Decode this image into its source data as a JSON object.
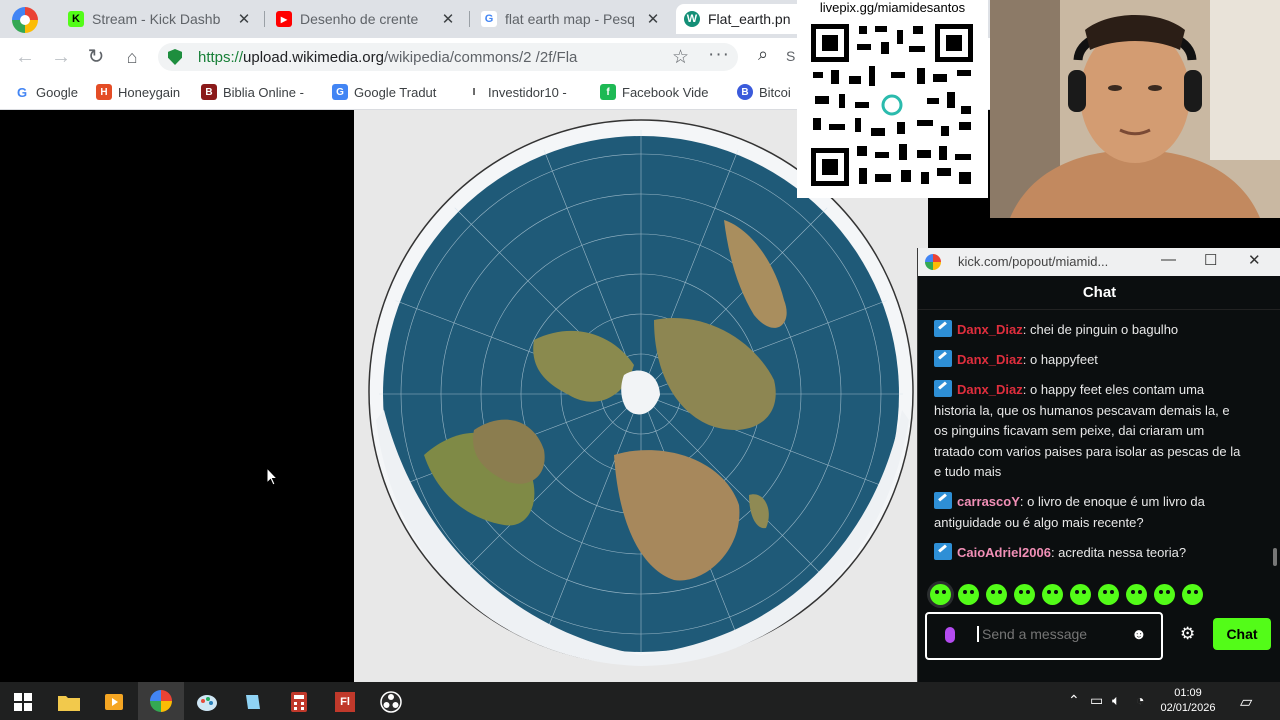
{
  "browser": {
    "tabs": [
      {
        "title": "Stream - Kick Dashb",
        "fav_color": "#53fc18",
        "fav_letter": "K"
      },
      {
        "title": "Desenho de crente",
        "fav_color": "#ff0000",
        "fav_letter": "▶"
      },
      {
        "title": "flat earth map - Pesq",
        "fav_color": "#4285f4",
        "fav_letter": "G"
      },
      {
        "title": "Flat_earth.pn",
        "fav_color": "#148f77",
        "fav_letter": "W"
      }
    ],
    "url_scheme": "https://",
    "url_host": "upload.wikimedia.org",
    "url_path": "/wikipedia/commons/2 /2f/Fla",
    "search_partial": "S",
    "bookmarks": [
      {
        "label": "Google",
        "color": "#4285f4",
        "letter": "G"
      },
      {
        "label": "Honeygain",
        "color": "#e44d26",
        "letter": "H"
      },
      {
        "label": "Biblia Online -",
        "color": "#8b1a1a",
        "letter": "B"
      },
      {
        "label": "Google Tradut",
        "color": "#4285f4",
        "letter": "G"
      },
      {
        "label": "Investidor10 -",
        "color": "#333333",
        "letter": "I"
      },
      {
        "label": "Facebook Vide",
        "color": "#1db954",
        "letter": "f"
      },
      {
        "label": "Bitcoi",
        "color": "#3b5bdb",
        "letter": "B"
      }
    ]
  },
  "overlay": {
    "qr_caption": "livepix.gg/miamidesantos"
  },
  "popout": {
    "window_title": "kick.com/popout/miamid...",
    "chat_title": "Chat",
    "messages": [
      {
        "user": "Danx_Diaz",
        "user_color": "#e02e3d",
        "text": ": chei de pinguin o bagulho"
      },
      {
        "user": "Danx_Diaz",
        "user_color": "#e02e3d",
        "text": ": o happyfeet"
      },
      {
        "user": "Danx_Diaz",
        "user_color": "#e02e3d",
        "text": ": o happy feet eles contam uma historia la, que os humanos pescavam demais la, e os pinguins ficavam sem peixe, dai criaram um tratado com varios paises para isolar as pescas de la e tudo mais"
      },
      {
        "user": "carrascoY",
        "user_color": "#f18fb6",
        "text": ": o livro de enoque é um livro da antiguidade ou é algo mais recente?"
      },
      {
        "user": "CaioAdriel2006",
        "user_color": "#f18fb6",
        "text": ": acredita nessa teoria?"
      }
    ],
    "input_placeholder": "Send a message",
    "chat_button": "Chat",
    "accent": "#53fc18"
  },
  "taskbar": {
    "time": "01:09",
    "date": "02/01/2026",
    "apps": [
      "start-icon",
      "file-explorer-icon",
      "media-player-icon",
      "browser-icon",
      "paint-icon",
      "notepad-icon",
      "calculator-icon",
      "flash-icon",
      "obs-icon"
    ]
  }
}
